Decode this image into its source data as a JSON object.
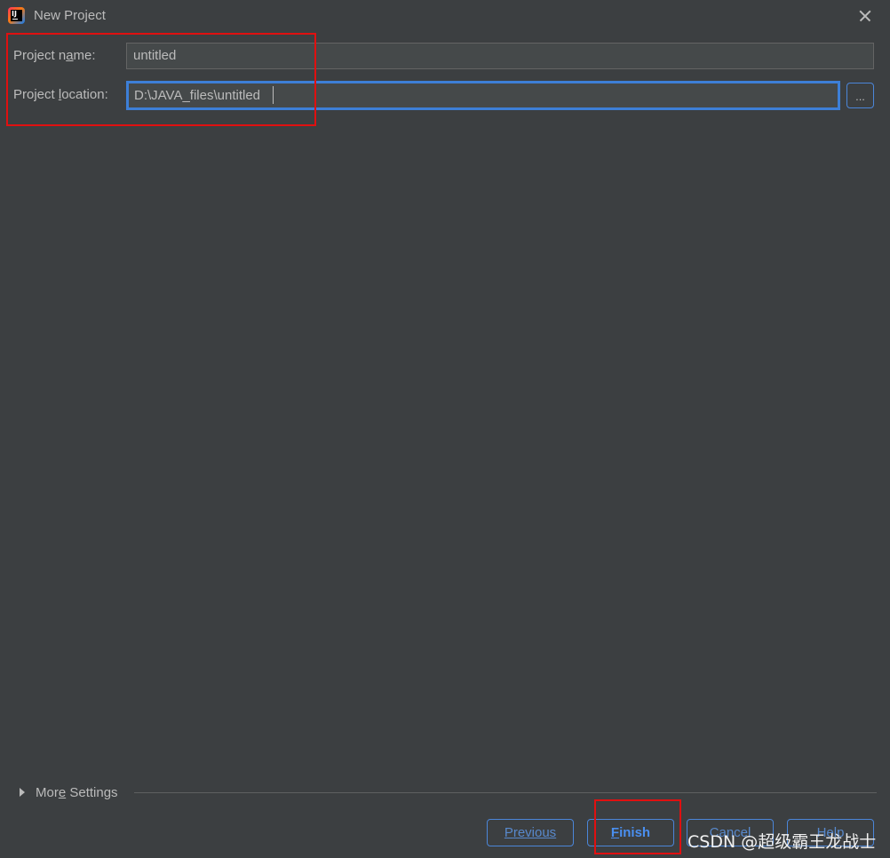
{
  "window": {
    "title": "New Project",
    "close_label": "×"
  },
  "form": {
    "project_name": {
      "label_before": "Project n",
      "label_mnemonic": "a",
      "label_after": "me:",
      "value": "untitled"
    },
    "project_location": {
      "label_before": "Project ",
      "label_mnemonic": "l",
      "label_after": "ocation:",
      "value": "D:\\JAVA_files\\untitled",
      "browse_label": "..."
    }
  },
  "more_settings": {
    "label_before": "Mor",
    "label_mnemonic": "e",
    "label_after": " Settings"
  },
  "buttons": {
    "previous": {
      "mnemonic": "P",
      "rest": "revious"
    },
    "finish": {
      "mnemonic": "F",
      "rest": "inish"
    },
    "cancel": {
      "label": "Cancel"
    },
    "help": {
      "label": "Help"
    }
  },
  "watermark": "CSDN @超级霸王龙战士",
  "colors": {
    "background": "#3c3f41",
    "field_bg": "#45494a",
    "focus_border": "#3d7fd7",
    "button_text": "#5889cc",
    "highlight_red": "#e01010"
  }
}
